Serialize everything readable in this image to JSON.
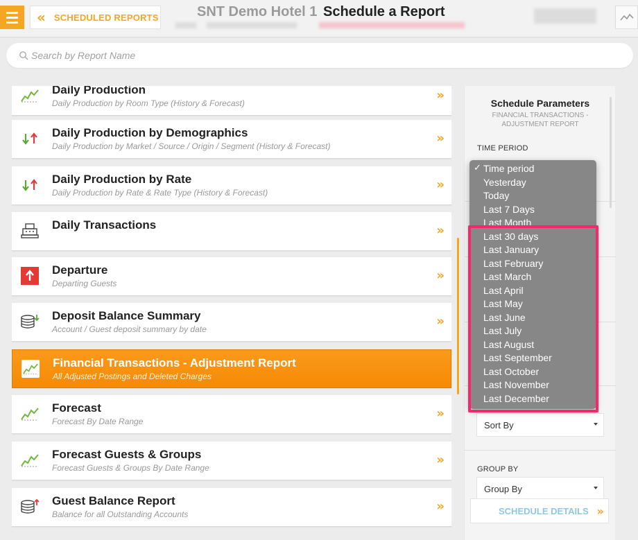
{
  "header": {
    "back_label": "SCHEDULED REPORTS",
    "hotel_name": "SNT Demo Hotel 1",
    "page_title": "Schedule a Report"
  },
  "search": {
    "placeholder": "Search by Report Name"
  },
  "reports": [
    {
      "title": "Daily Production",
      "subtitle": "Daily Production by Room Type (History & Forecast)",
      "icon": "trend-line-icon"
    },
    {
      "title": "Daily Production by Demographics",
      "subtitle": "Daily Production by Market / Source / Origin / Segment (History & Forecast)",
      "icon": "up-down-arrows-icon"
    },
    {
      "title": "Daily Production by Rate",
      "subtitle": "Daily Production by Rate & Rate Type (History & Forecast)",
      "icon": "up-down-arrows-icon"
    },
    {
      "title": "Daily Transactions",
      "subtitle": "",
      "icon": "cash-register-icon"
    },
    {
      "title": "Departure",
      "subtitle": "Departing Guests",
      "icon": "departure-arrow-icon"
    },
    {
      "title": "Deposit Balance Summary",
      "subtitle": "Account / Guest deposit summary by date",
      "icon": "coin-stack-icon"
    },
    {
      "title": "Financial Transactions - Adjustment Report",
      "subtitle": "All Adjusted Postings and Deleted Charges",
      "icon": "trend-line-icon"
    },
    {
      "title": "Forecast",
      "subtitle": "Forecast By Date Range",
      "icon": "trend-line-icon"
    },
    {
      "title": "Forecast Guests & Groups",
      "subtitle": "Forecast Guests & Groups By Date Range",
      "icon": "trend-line-icon"
    },
    {
      "title": "Guest Balance Report",
      "subtitle": "Balance for all Outstanding Accounts",
      "icon": "coin-stack-icon"
    }
  ],
  "panel": {
    "title": "Schedule Parameters",
    "subtitle": "FINANCIAL TRANSACTIONS - ADJUSTMENT REPORT",
    "time_period_label": "TIME PERIOD",
    "sort_by_value": "Sort By",
    "group_by_label": "GROUP BY",
    "group_by_value": "Group By",
    "schedule_button": "SCHEDULE DETAILS"
  },
  "dropdown": {
    "check": "✓",
    "options": [
      "Time period",
      "Yesterday",
      "Today",
      "Last 7 Days",
      "Last Month",
      "Last 30 days",
      "Last January",
      "Last February",
      "Last March",
      "Last April",
      "Last May",
      "Last June",
      "Last July",
      "Last August",
      "Last September",
      "Last October",
      "Last November",
      "Last December"
    ]
  },
  "colors": {
    "accent": "#f6a623",
    "highlight": "#f2296b",
    "dropdown_bg": "#878787",
    "link_blue": "#8ec8e6"
  }
}
